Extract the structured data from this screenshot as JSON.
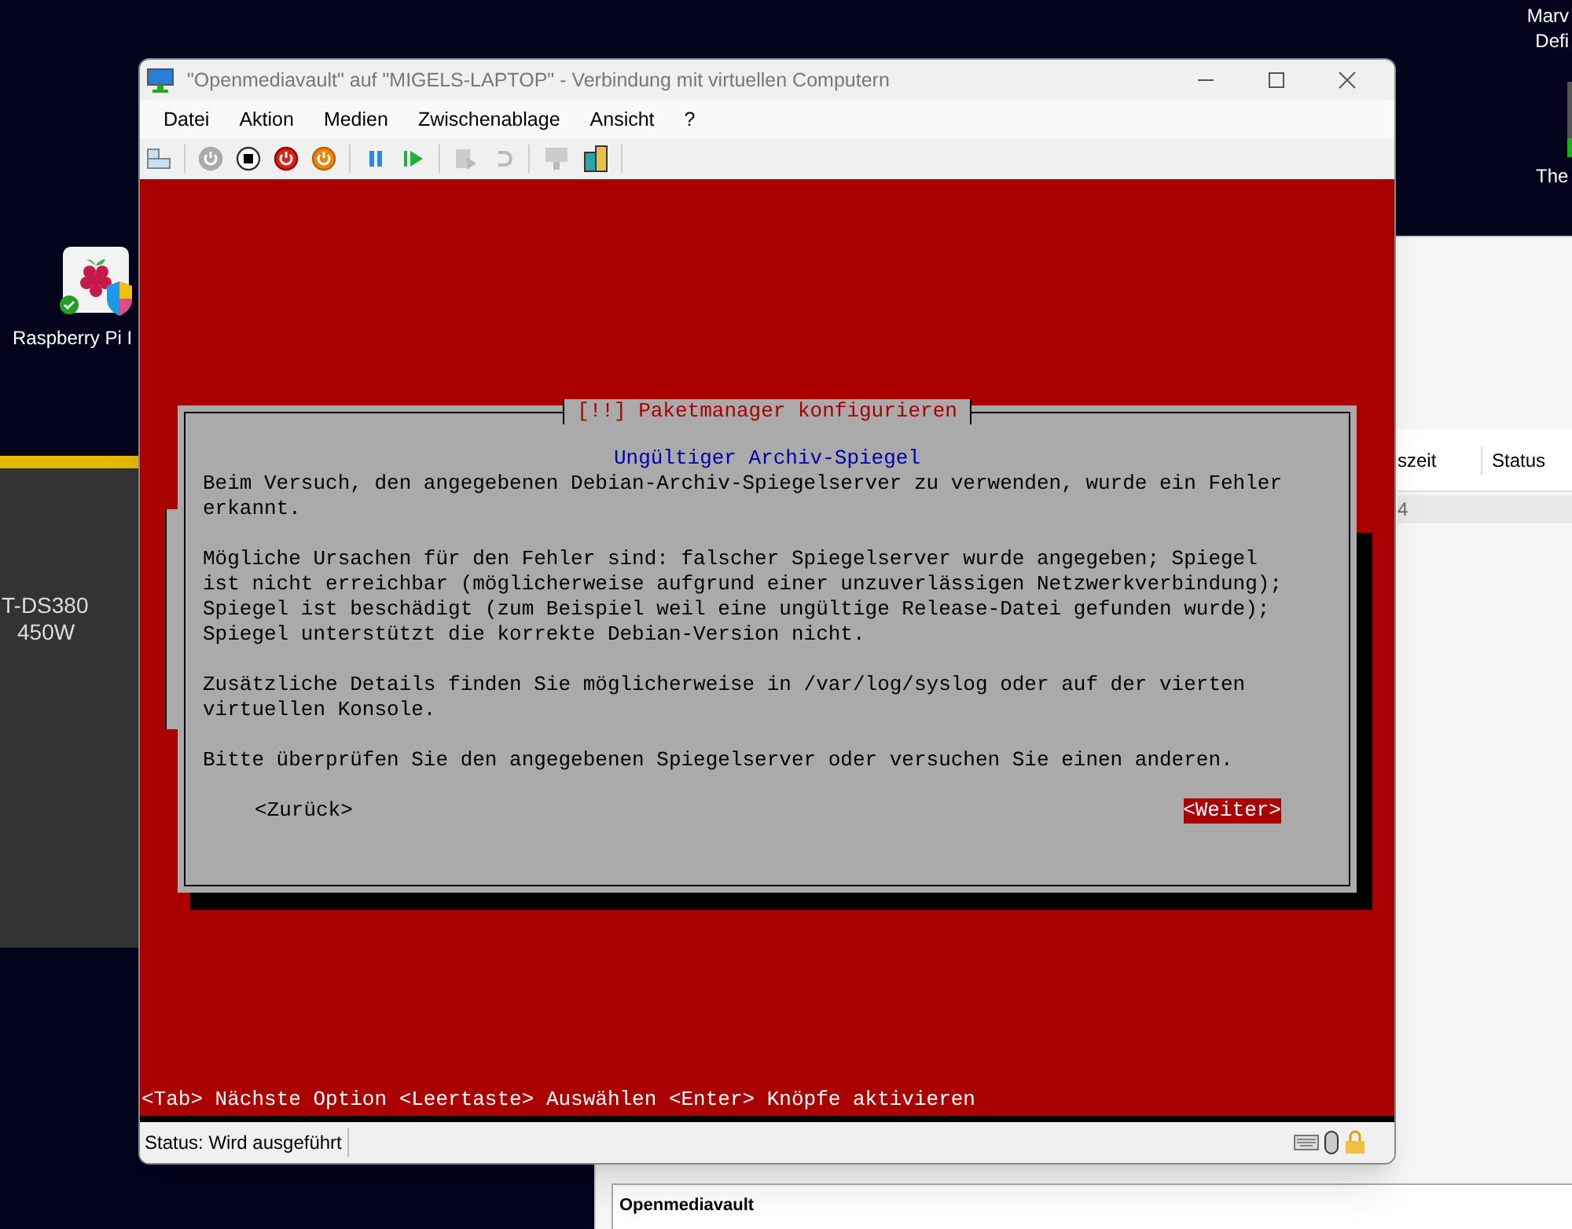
{
  "desktop": {
    "icon_label": "Raspberry Pi I",
    "panel_lines": [
      "T-DS380",
      "450W"
    ],
    "top_right_lines": [
      "Marv",
      "Defi"
    ],
    "thumb_label": "The"
  },
  "background_window": {
    "columns": [
      "szeit",
      "Status"
    ],
    "row_text": "4",
    "section_title": "Openmediavault"
  },
  "window": {
    "title": "\"Openmediavault\" auf \"MIGELS-LAPTOP\" - Verbindung mit virtuellen Computern",
    "menu": [
      "Datei",
      "Aktion",
      "Medien",
      "Zwischenablage",
      "Ansicht",
      "?"
    ],
    "console": {
      "dialog_title": "[!!] Paketmanager konfigurieren",
      "heading": "Ungültiger Archiv-Spiegel",
      "paragraphs": [
        [
          "Beim Versuch, den angegebenen Debian-Archiv-Spiegelserver zu verwenden, wurde ein Fehler",
          "erkannt."
        ],
        [
          "Mögliche Ursachen für den Fehler sind: falscher Spiegelserver wurde angegeben; Spiegel",
          "ist nicht erreichbar (möglicherweise aufgrund einer unzuverlässigen Netzwerkverbindung);",
          "Spiegel ist beschädigt (zum Beispiel weil eine ungültige Release-Datei gefunden wurde);",
          "Spiegel unterstützt die korrekte Debian-Version nicht."
        ],
        [
          "Zusätzliche Details finden Sie möglicherweise in /var/log/syslog oder auf der vierten",
          "virtuellen Konsole."
        ],
        [
          "Bitte überprüfen Sie den angegebenen Spiegelserver oder versuchen Sie einen anderen."
        ]
      ],
      "buttons": [
        {
          "label": "<Zurück>",
          "selected": false
        },
        {
          "label": "<Weiter>",
          "selected": true
        }
      ],
      "hint": "<Tab> Nächste Option <Leertaste> Auswählen <Enter> Knöpfe aktivieren"
    },
    "status": "Status: Wird ausgeführt"
  }
}
